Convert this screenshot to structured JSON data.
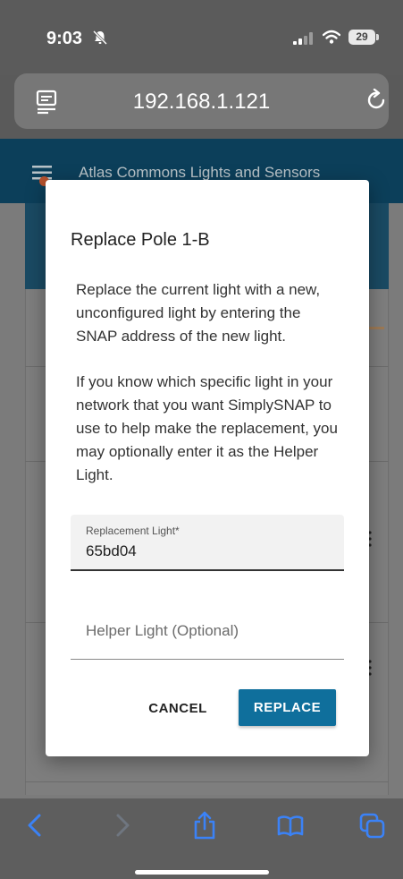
{
  "status_bar": {
    "time": "9:03",
    "battery": "29",
    "icons": [
      "bell-slash-icon",
      "signal-icon",
      "wifi-icon",
      "battery-icon"
    ]
  },
  "browser": {
    "url": "192.168.1.121",
    "icons": [
      "reader-mode-icon",
      "reload-icon"
    ]
  },
  "app": {
    "title": "Atlas Commons Lights and Sensors"
  },
  "dialog": {
    "title": "Replace Pole 1-B",
    "paragraph1": "Replace the current light with a new, unconfigured light by entering the SNAP address of the new light.",
    "paragraph2": "If you know which specific light in your network that you want SimplySNAP to use to help make the replacement, you may optionally enter it as the Helper Light.",
    "replacement_field": {
      "label": "Replacement Light*",
      "value": "65bd04"
    },
    "helper_field": {
      "placeholder": "Helper Light (Optional)",
      "value": ""
    },
    "cancel_label": "CANCEL",
    "replace_label": "REPLACE"
  },
  "toolbar": {
    "icons": [
      "back-icon",
      "forward-icon",
      "share-icon",
      "bookmarks-icon",
      "tabs-icon"
    ]
  },
  "colors": {
    "accent": "#0f6f9c",
    "app_bar": "#0c3f5a",
    "toolbar_icon": "#3b82f6"
  }
}
